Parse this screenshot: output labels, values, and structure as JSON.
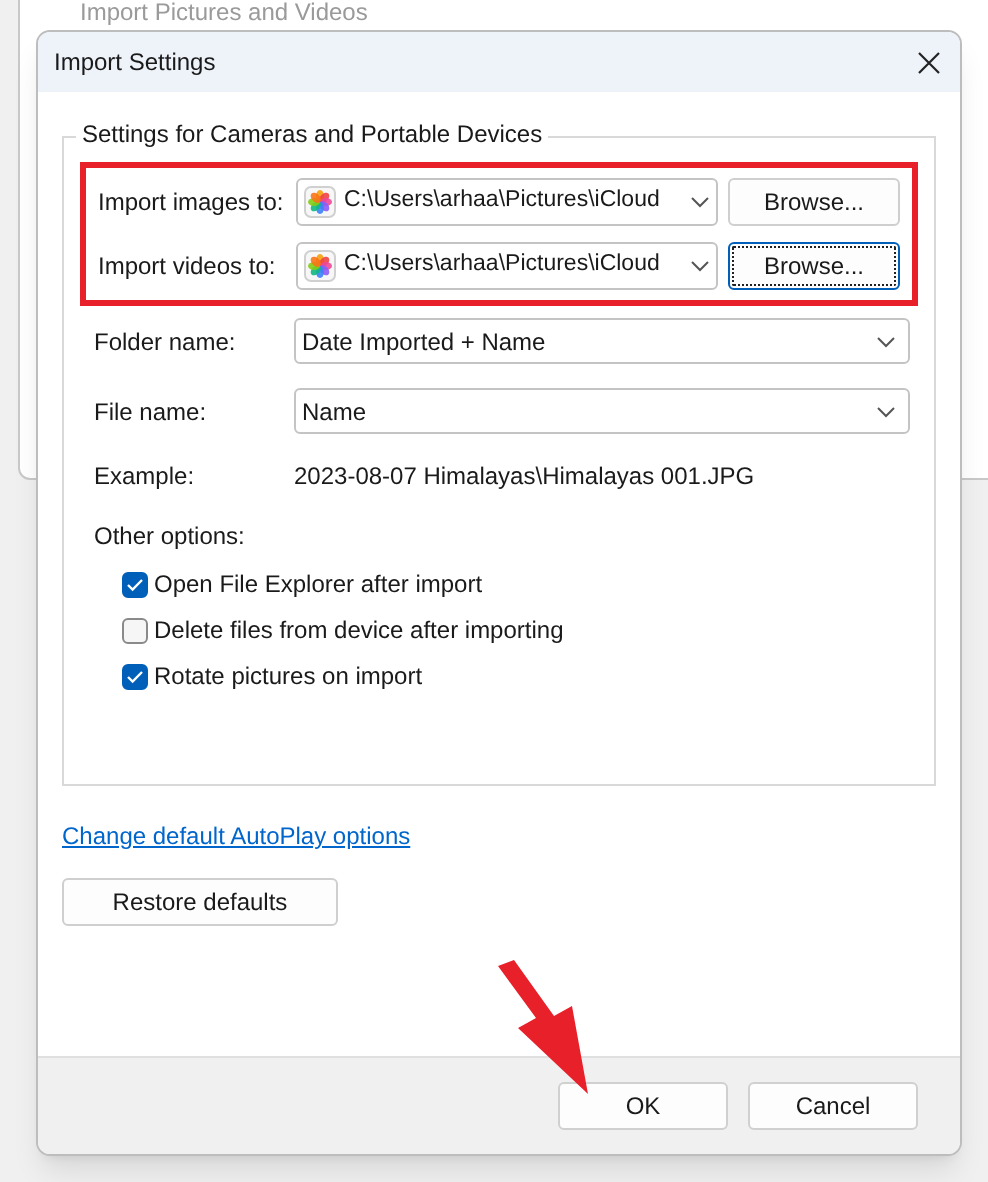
{
  "background_window": {
    "title": "Import Pictures and Videos"
  },
  "dialog": {
    "title": "Import Settings"
  },
  "group": {
    "title": "Settings for Cameras and Portable Devices"
  },
  "destinations": [
    {
      "label": "Import images to:",
      "value": "C:\\Users\\arhaa\\Pictures\\iCloud",
      "button": "Browse...",
      "focused": false
    },
    {
      "label": "Import videos to:",
      "value": "C:\\Users\\arhaa\\Pictures\\iCloud",
      "button": "Browse...",
      "focused": true
    }
  ],
  "fields": [
    {
      "label": "Folder name:",
      "value": "Date Imported + Name"
    },
    {
      "label": "File name:",
      "value": "Name"
    }
  ],
  "example": {
    "label": "Example:",
    "value": "2023-08-07 Himalayas\\Himalayas 001.JPG"
  },
  "other_options": {
    "label": "Other options:",
    "options": [
      {
        "label": "Open File Explorer after import",
        "checked": true
      },
      {
        "label": "Delete files from device after importing",
        "checked": false
      },
      {
        "label": "Rotate pictures on import",
        "checked": true
      }
    ]
  },
  "link": "Change default AutoPlay options",
  "restore_button": "Restore defaults",
  "buttons": [
    {
      "label": "OK"
    },
    {
      "label": "Cancel"
    }
  ]
}
